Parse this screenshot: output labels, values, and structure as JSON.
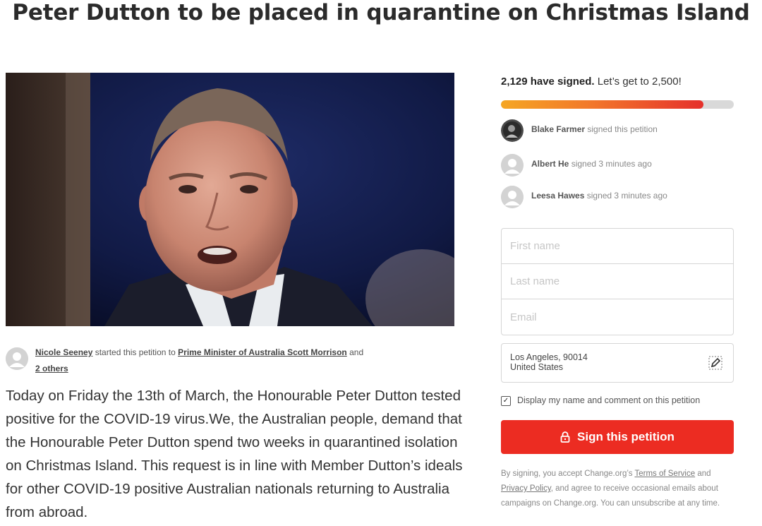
{
  "page": {
    "title": "Peter Dutton to be placed in quarantine on Christmas Island"
  },
  "hero_image": {
    "alt": "Peter Dutton"
  },
  "starter": {
    "name": "Nicole Seeney",
    "text_middle": "started this petition to",
    "target": "Prime Minister of Australia Scott Morrison",
    "text_and": "and",
    "others": "2 others"
  },
  "body": {
    "text": "Today on Friday the 13th of March, the Honourable Peter Dutton tested positive for the COVID-19 virus.We, the Australian people, demand that the Honourable Peter Dutton spend two weeks in quarantined isolation on Christmas Island.  This request is in line with Member Dutton’s ideals for other COVID-19 positive Australian nationals returning to Australia from abroad."
  },
  "signatures": {
    "count_text": "2,129 have signed.",
    "goal_text": "Let’s get to 2,500!",
    "signed": 2129,
    "goal": 2500,
    "progress_fraction": 0.87
  },
  "recent_signers": [
    {
      "name": "Blake Farmer",
      "action": "signed this petition",
      "avatar": "photo"
    },
    {
      "name": "Albert He",
      "action": "signed 3 minutes ago",
      "avatar": "default"
    },
    {
      "name": "Leesa Hawes",
      "action": "signed 3 minutes ago",
      "avatar": "default"
    }
  ],
  "form": {
    "first_name_placeholder": "First name",
    "last_name_placeholder": "Last name",
    "email_placeholder": "Email",
    "location_line1": "Los Angeles, 90014",
    "location_line2": "United States",
    "display_label": "Display my name and comment on this petition",
    "display_checked": true,
    "sign_button": "Sign this petition"
  },
  "disclaimer": {
    "prefix": "By signing, you accept Change.org’s",
    "terms": "Terms of Service",
    "and": "and",
    "privacy": "Privacy Policy",
    "suffix": ", and agree to receive occasional emails about campaigns on Change.org. You can unsubscribe at any time."
  },
  "colors": {
    "accent_red": "#ec2c22",
    "progress_start": "#f5a623",
    "progress_end": "#e5302b"
  }
}
